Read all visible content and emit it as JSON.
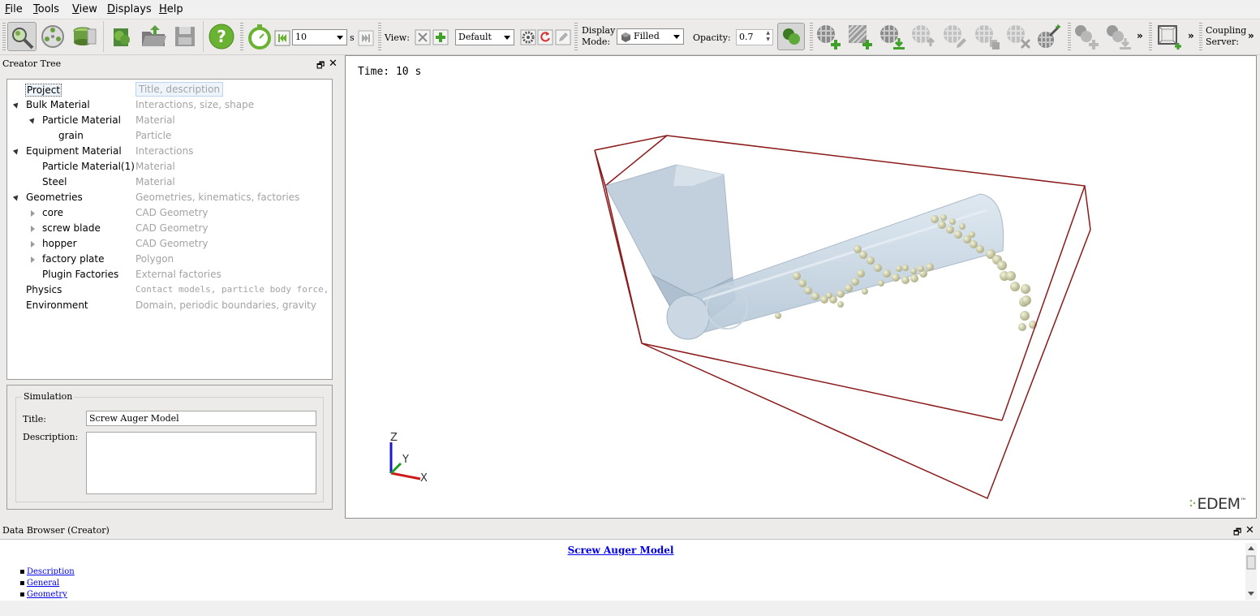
{
  "menu": [
    "File",
    "Tools",
    "View",
    "Displays",
    "Help"
  ],
  "toolbar": {
    "time_step_value": "10",
    "time_unit": "s",
    "view_label": "View:",
    "view_preset": "Default",
    "display_mode_label_1": "Display",
    "display_mode_label_2": "Mode:",
    "display_mode_value": "Filled",
    "opacity_label": "Opacity:",
    "opacity_value": "0.7",
    "coupling_label_1": "Coupling",
    "coupling_label_2": "Server:",
    "more_chevron": "»"
  },
  "creator_tree": {
    "title": "Creator Tree",
    "rows": [
      {
        "name": "Project",
        "desc": "Title, description"
      },
      {
        "name": "Bulk Material",
        "desc": "Interactions, size, shape"
      },
      {
        "name": "Particle Material",
        "desc": "Material"
      },
      {
        "name": "grain",
        "desc": "Particle"
      },
      {
        "name": "Equipment Material",
        "desc": "Interactions"
      },
      {
        "name": "Particle Material(1)",
        "desc": "Material"
      },
      {
        "name": "Steel",
        "desc": "Material"
      },
      {
        "name": "Geometries",
        "desc": "Geometries, kinematics, factories"
      },
      {
        "name": "core",
        "desc": "CAD Geometry"
      },
      {
        "name": "screw blade",
        "desc": "CAD Geometry"
      },
      {
        "name": "hopper",
        "desc": "CAD Geometry"
      },
      {
        "name": "factory plate",
        "desc": "Polygon"
      },
      {
        "name": "Plugin Factories",
        "desc": "External factories"
      },
      {
        "name": "Physics",
        "desc": "Contact models, particle body force, fi⋯"
      },
      {
        "name": "Environment",
        "desc": "Domain, periodic boundaries, gravity"
      }
    ]
  },
  "simulation": {
    "group_label": "Simulation",
    "title_label": "Title:",
    "title_value": "Screw Auger Model",
    "description_label": "Description:",
    "description_value": ""
  },
  "viewport": {
    "time_text": "Time: 10 s",
    "axis_z": "Z",
    "axis_y": "Y",
    "axis_x": "X",
    "logo": "EDEM",
    "logo_tm": "™"
  },
  "data_browser": {
    "title": "Data Browser (Creator)",
    "heading": "Screw Auger Model",
    "links": [
      "Description",
      "General",
      "Geometry"
    ]
  },
  "colors": {
    "domain_box": "#8b1a1a",
    "geometry": "#b7c8d8",
    "particles": "#d9d9b0",
    "link": "#0000ee"
  }
}
